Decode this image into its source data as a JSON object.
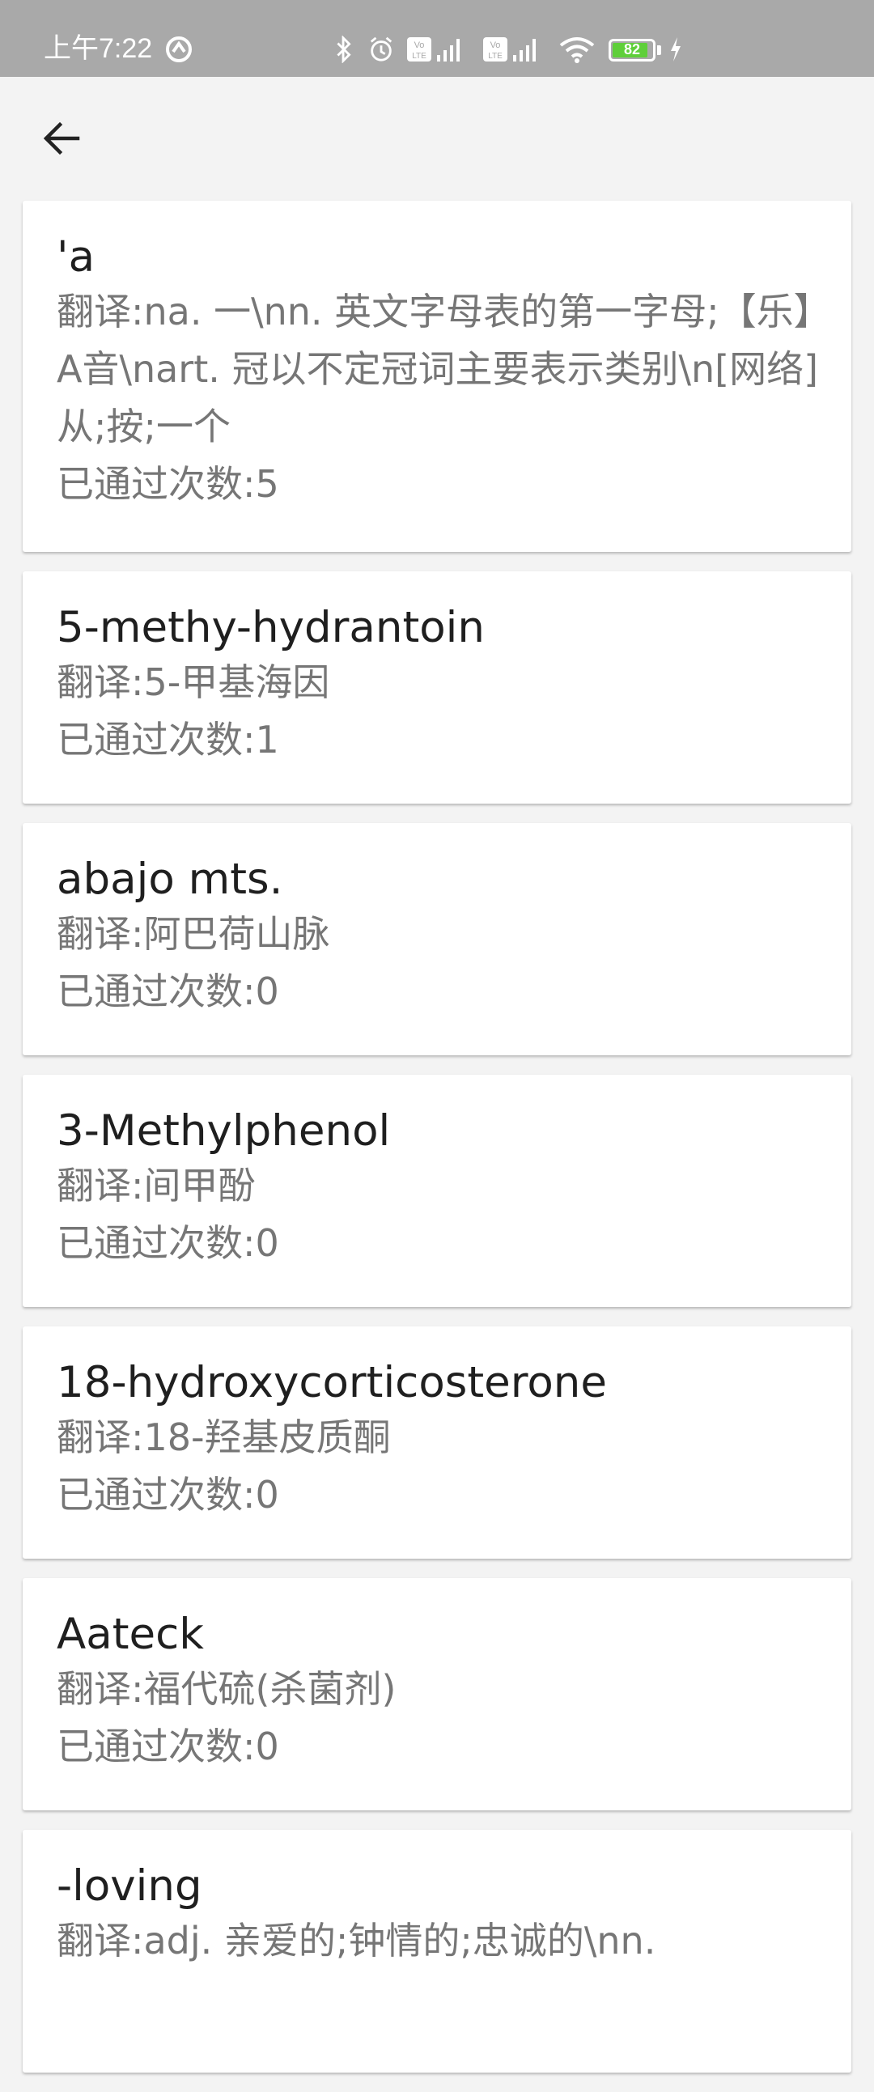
{
  "status_bar": {
    "time": "上午7:22",
    "battery_level": "82",
    "icons": [
      "vpn-icon",
      "bluetooth-icon",
      "alarm-icon",
      "volte-icon",
      "signal-icon",
      "volte-icon",
      "signal-icon",
      "wifi-icon",
      "battery-icon",
      "charging-icon"
    ],
    "colors": {
      "background": "#a9a9a9",
      "battery_fill": "#5fcf3a"
    }
  },
  "app_bar": {
    "back_icon": "arrow-left-icon"
  },
  "words": [
    {
      "word": "'a",
      "translation": "翻译:na. 一\\nn. 英文字母表的第一字母;【乐】A音\\nart. 冠以不定冠词主要表示类别\\n[网络] 从;按;一个",
      "passes": "已通过次数:5"
    },
    {
      "word": "5-methy-hydrantoin",
      "translation": "翻译:5-甲基海因",
      "passes": "已通过次数:1"
    },
    {
      "word": "abajo mts.",
      "translation": "翻译:阿巴荷山脉",
      "passes": "已通过次数:0"
    },
    {
      "word": "3-Methylphenol",
      "translation": "翻译:间甲酚",
      "passes": "已通过次数:0"
    },
    {
      "word": "18-hydroxycorticosterone",
      "translation": "翻译:18-羟基皮质酮",
      "passes": "已通过次数:0"
    },
    {
      "word": "Aateck",
      "translation": "翻译:福代硫(杀菌剂)",
      "passes": "已通过次数:0"
    },
    {
      "word": "-loving",
      "translation": "翻译:adj. 亲爱的;钟情的;忠诚的\\nn.",
      "passes": ""
    }
  ]
}
